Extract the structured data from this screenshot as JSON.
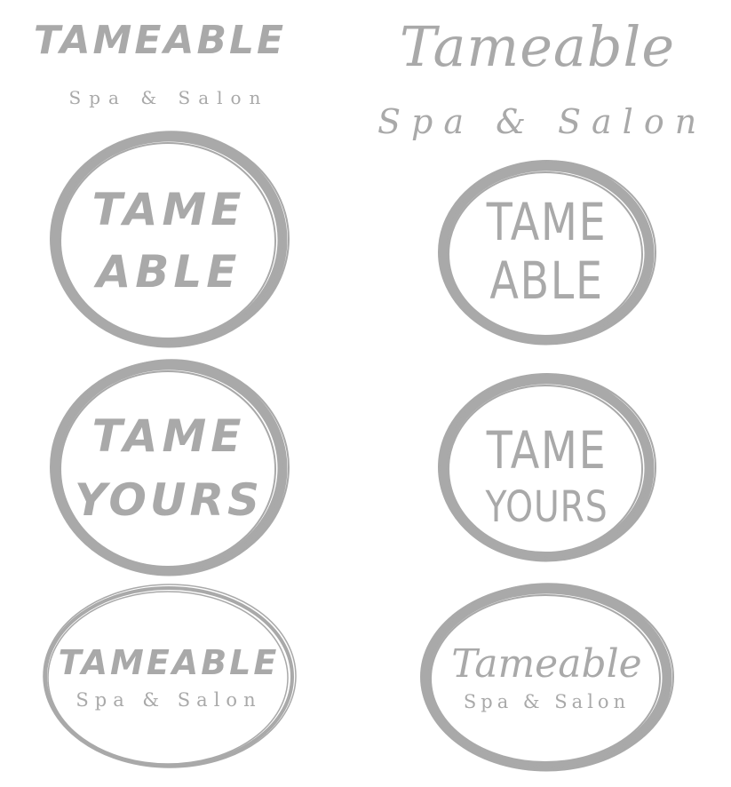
{
  "logos": {
    "top_left": {
      "title": "TAMEABLE",
      "subtitle": "Spa & Salon"
    },
    "top_right": {
      "title": "Tameable",
      "subtitle": "Spa & Salon"
    },
    "ring_left_1": {
      "line1": "TAME",
      "line2": "ABLE"
    },
    "ring_right_1": {
      "line1": "TAME",
      "line2": "ABLE"
    },
    "ring_left_2": {
      "line1": "TAME",
      "line2": "YOURS"
    },
    "ring_right_2": {
      "line1": "TAME",
      "line2": "YOURS"
    },
    "ring_left_3": {
      "title": "TAMEABLE",
      "subtitle": "Spa & Salon"
    },
    "ring_right_3": {
      "title": "Tameable",
      "subtitle": "Spa & Salon"
    }
  },
  "colors": {
    "ink": "#a9a9a9",
    "background": "#ffffff"
  }
}
